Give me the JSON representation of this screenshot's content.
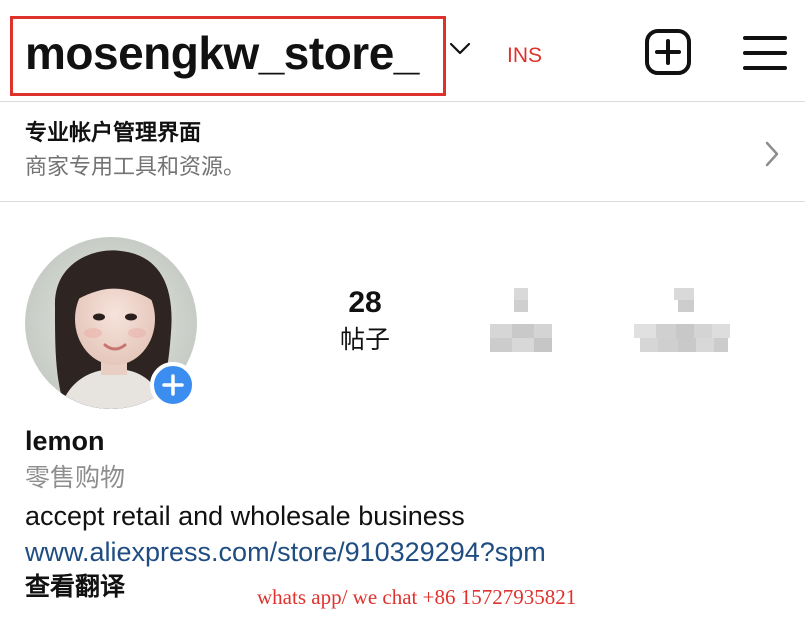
{
  "header": {
    "username": "mosengkw_store_",
    "overlay_tag": "INS",
    "icons": {
      "account_switch": "chevron-down-icon",
      "new_post": "plus-square-icon",
      "menu": "hamburger-menu-icon"
    },
    "highlight_color": "#e0322d"
  },
  "professional_dashboard": {
    "title": "专业帐户管理界面",
    "subtitle": "商家专用工具和资源。",
    "icon": "chevron-right-icon"
  },
  "profile": {
    "avatar_badge_icon": "plus-icon",
    "badge_color": "#3b8ef0",
    "stats": {
      "posts": {
        "value": "28",
        "label": "帖子"
      }
    },
    "display_name": "lemon",
    "category": "零售购物",
    "bio": "accept retail and wholesale business",
    "link": "www.aliexpress.com/store/910329294?spm",
    "link_color": "#1f4d82",
    "translate_label": "查看翻译"
  },
  "overlay": {
    "contact_text": "whats app/ we chat +86 15727935821",
    "color": "#e0322d"
  }
}
